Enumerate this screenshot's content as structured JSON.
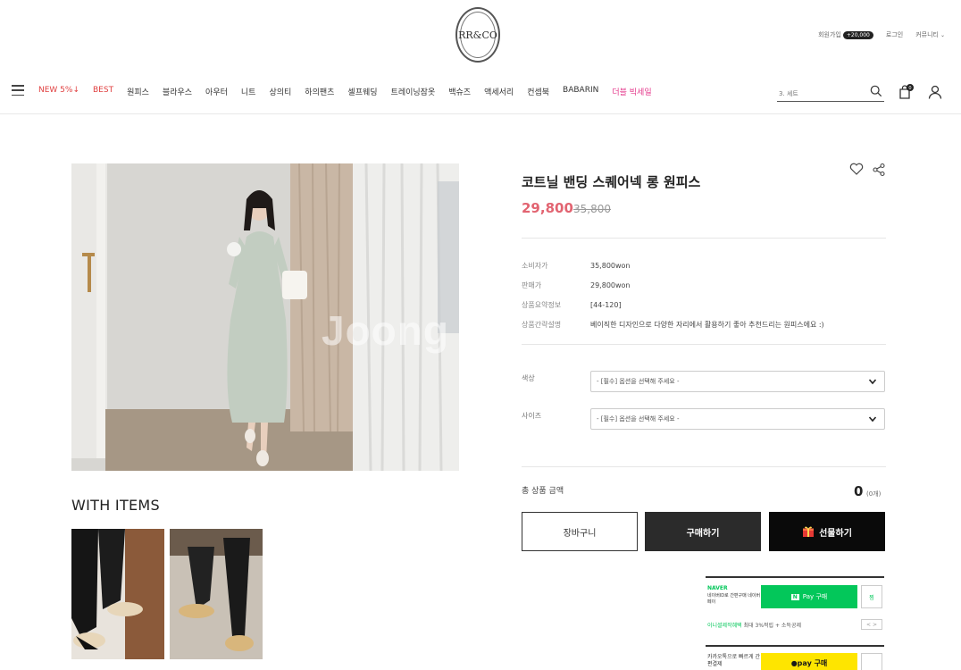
{
  "header": {
    "logo_text": "RR&CO",
    "util": {
      "signup": "회원가입",
      "signup_badge": "+20,000",
      "login": "로그인",
      "community": "커뮤니티"
    },
    "menu": [
      {
        "label": "NEW 5%↓",
        "color": "#e04040"
      },
      {
        "label": "BEST",
        "color": "#e04040"
      },
      {
        "label": "원피스"
      },
      {
        "label": "블라우스"
      },
      {
        "label": "아우터"
      },
      {
        "label": "니트"
      },
      {
        "label": "상의티"
      },
      {
        "label": "하의팬츠"
      },
      {
        "label": "셀프웨딩"
      },
      {
        "label": "트레이닝잠옷"
      },
      {
        "label": "백슈즈"
      },
      {
        "label": "액세서리"
      },
      {
        "label": "컨셉북"
      },
      {
        "label": "BABARIN"
      },
      {
        "label": "더블 빅세일",
        "color": "#e43a8c"
      }
    ],
    "search_placeholder": "3. 셰트",
    "cart_count": "0"
  },
  "product": {
    "image_watermark": "Joong",
    "title": "코트닐 밴딩 스퀘어넥 롱 원피스",
    "price": "29,800",
    "original_price": "35,800",
    "info": [
      {
        "label": "소비자가",
        "value": "35,800won"
      },
      {
        "label": "판매가",
        "value": "29,800won"
      },
      {
        "label": "상품요약정보",
        "value": "[44-120]"
      },
      {
        "label": "상품간략설명",
        "value": "베이직한 디자인으로 다양한 자리에서 활용하기 좋아 추천드리는 원피스에요 :)"
      }
    ],
    "options": [
      {
        "label": "색상",
        "value": "- [필수] 옵션을 선택해 주세요 -"
      },
      {
        "label": "사이즈",
        "value": "- [필수] 옵션을 선택해 주세요 -"
      }
    ],
    "total_label": "총 상품 금액",
    "total_amount": "0",
    "total_count": "(0개)",
    "buttons": {
      "cart": "장바구니",
      "buy": "구매하기",
      "gift": "선물하기"
    }
  },
  "with_items": {
    "title": "WITH ITEMS"
  },
  "naver_pay": {
    "brand": "NAVER",
    "desc": "네이버ID로 간편구매 네이버페이",
    "button": "Pay 구매",
    "button_mark": "N",
    "wish": "찜",
    "event_highlight": "이니셜제작혜택",
    "event_rest": "최대 3%적립 + 소득공제",
    "arrows": "< >"
  },
  "kakao_pay": {
    "desc": "카카오톡으로 빠르게 간편결제",
    "button": "●pay 구매"
  },
  "colors": {
    "price": "#e26471",
    "menu_accent": "#e04040",
    "sale_accent": "#e43a8c",
    "naver_green": "#03c75a",
    "kakao_yellow": "#fee500"
  }
}
